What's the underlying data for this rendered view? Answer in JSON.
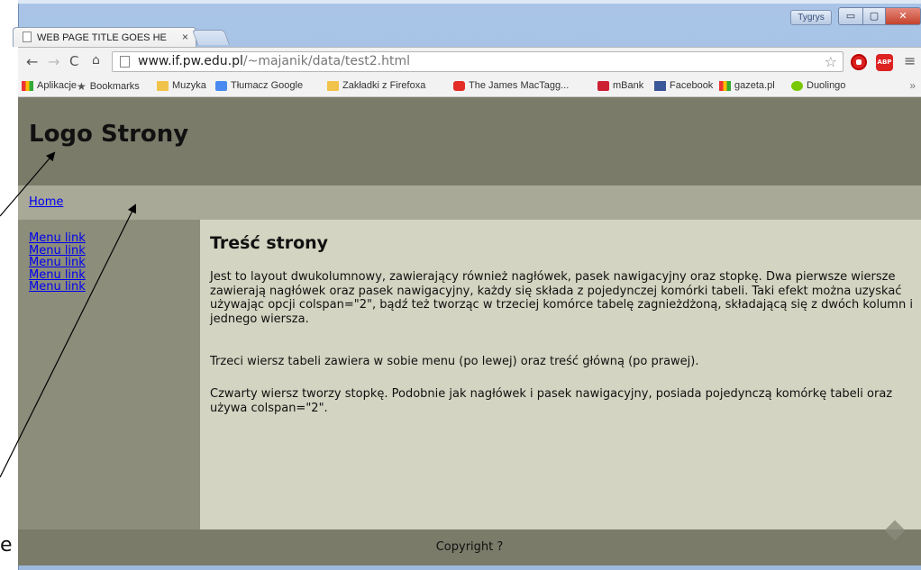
{
  "browser": {
    "tab_title": "WEB PAGE TITLE GOES HE",
    "tab_close": "×",
    "user_button": "Tygrys",
    "win_minimize": "▭",
    "win_maximize": "▢",
    "win_close": "✕",
    "back": "←",
    "forward": "→",
    "reload": "C",
    "home": "⌂",
    "url_host": "www.if.pw.edu.pl",
    "url_path": "/~majanik/data/test2.html",
    "star": "☆",
    "abp_label": "ABP",
    "menu": "≡",
    "bookmarks_more": "»",
    "bookmarks": [
      {
        "label": "Aplikacje",
        "icon": "apps-icon"
      },
      {
        "label": "Bookmarks",
        "icon": "star-icon"
      },
      {
        "label": "Muzyka",
        "icon": "folder-icon"
      },
      {
        "label": "Tłumacz Google",
        "icon": "google-translate-icon"
      },
      {
        "label": "Zakładki z Firefoxa",
        "icon": "folder-icon"
      },
      {
        "label": "The James MacTagg...",
        "icon": "youtube-icon"
      },
      {
        "label": "mBank",
        "icon": "mbank-icon"
      },
      {
        "label": "Facebook",
        "icon": "facebook-icon"
      },
      {
        "label": "gazeta.pl",
        "icon": "gazeta-icon"
      },
      {
        "label": "Duolingo",
        "icon": "duolingo-icon"
      }
    ]
  },
  "page": {
    "logo": "Logo Strony",
    "home_link": "Home",
    "menu_links": [
      "Menu link",
      "Menu link",
      "Menu link",
      "Menu link",
      "Menu link"
    ],
    "content_title": "Treść strony",
    "paragraphs": [
      "Jest to layout dwukolumnowy, zawierający również nagłówek, pasek nawigacyjny oraz stopkę. Dwa pierwsze wiersze zawierają nagłówek oraz pasek nawigacyjny, każdy się składa z pojedynczej komórki tabeli. Taki efekt można uzyskać używając opcji colspan=\"2\", bądź też tworząc w trzeciej komórce tabelę zagnieżdżoną, składającą się z dwóch kolumn i jednego wiersza.",
      "Trzeci wiersz tabeli zawiera w sobie menu (po lewej) oraz treść główną (po prawej).",
      "Czwarty wiersz tworzy stopkę. Podobnie jak nagłówek i pasek nawigacyjny, posiada pojedynczą komórkę tabeli oraz używa colspan=\"2\"."
    ],
    "footer": "Copyright ?"
  },
  "annotation": {
    "cut_letter": "e"
  },
  "colors": {
    "header": "#7a7b69",
    "navbar": "#a8a997",
    "sidebar": "#8c8d7a",
    "content": "#d3d4c1",
    "link": "#0000ee"
  }
}
